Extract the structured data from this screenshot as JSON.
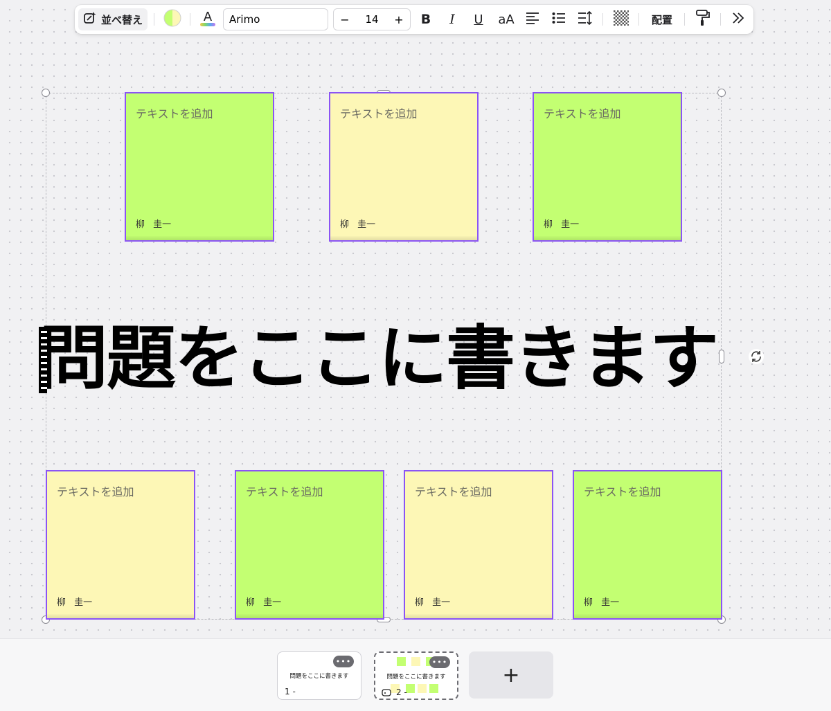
{
  "toolbar": {
    "sort_label": "並べ替え",
    "font_name": "Arimo",
    "font_size": "14",
    "minus": "−",
    "plus": "+",
    "bold": "B",
    "italic": "I",
    "underline": "U",
    "case": "aA",
    "arrange_label": "配置",
    "colors": {
      "fill_left": "#c3ff72",
      "fill_right": "#fdf7b6"
    }
  },
  "notes": [
    {
      "placeholder": "テキストを追加",
      "author": "柳 圭一",
      "color": "green"
    },
    {
      "placeholder": "テキストを追加",
      "author": "柳 圭一",
      "color": "yellow"
    },
    {
      "placeholder": "テキストを追加",
      "author": "柳 圭一",
      "color": "green"
    },
    {
      "placeholder": "テキストを追加",
      "author": "柳 圭一",
      "color": "yellow"
    },
    {
      "placeholder": "テキストを追加",
      "author": "柳 圭一",
      "color": "green"
    },
    {
      "placeholder": "テキストを追加",
      "author": "柳 圭一",
      "color": "yellow"
    },
    {
      "placeholder": "テキストを追加",
      "author": "柳 圭一",
      "color": "green"
    }
  ],
  "title": "問題をここに書きます",
  "pages": [
    {
      "title": "問題をここに書きます",
      "number": "1 -"
    },
    {
      "title": "問題をここに書きます",
      "number": "2 -"
    }
  ],
  "more": "•••",
  "add_page": "+",
  "palette": {
    "green": "#c3ff72",
    "yellow": "#fdf7b6",
    "selection": "#8b54f5"
  }
}
